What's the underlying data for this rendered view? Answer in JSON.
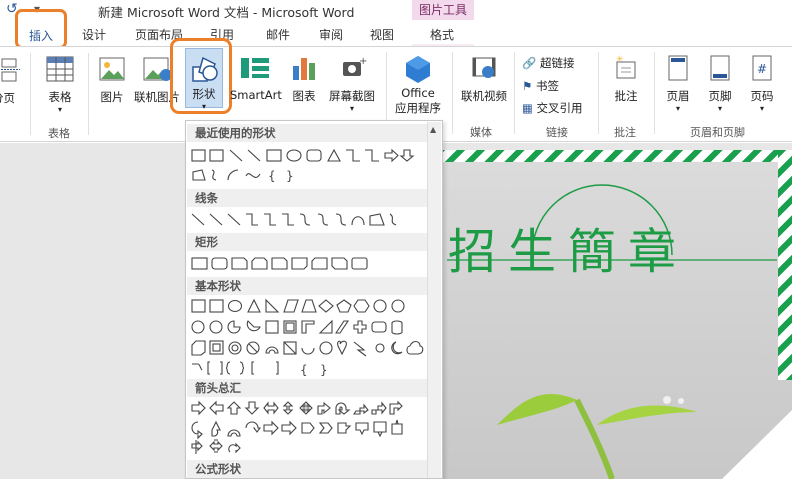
{
  "window": {
    "title": "新建 Microsoft Word 文档 - Microsoft Word",
    "context_group": "图片工具"
  },
  "tabs": [
    {
      "label": "插入"
    },
    {
      "label": "设计"
    },
    {
      "label": "页面布局"
    },
    {
      "label": "引用"
    },
    {
      "label": "邮件"
    },
    {
      "label": "审阅"
    },
    {
      "label": "视图"
    },
    {
      "label": "格式"
    }
  ],
  "ribbon": {
    "page": {
      "label": "分页"
    },
    "table": {
      "label": "表格",
      "group": "表格"
    },
    "picture": {
      "label": "图片"
    },
    "online_picture": {
      "label": "联机图片"
    },
    "shapes": {
      "label": "形状"
    },
    "smartart": {
      "label": "SmartArt"
    },
    "chart": {
      "label": "图表"
    },
    "screenshot": {
      "label": "屏幕截图"
    },
    "office_apps": {
      "label1": "Office",
      "label2": "应用程序"
    },
    "online_video": {
      "label": "联机视频",
      "group": "媒体"
    },
    "links": {
      "hyperlink": "超链接",
      "bookmark": "书签",
      "cross_ref": "交叉引用",
      "group": "链接"
    },
    "comment": {
      "label": "批注",
      "group": "批注"
    },
    "header": {
      "label": "页眉"
    },
    "footer": {
      "label": "页脚"
    },
    "page_number": {
      "label": "页码"
    },
    "header_footer_group": "页眉和页脚"
  },
  "shapes_menu": {
    "categories": [
      "最近使用的形状",
      "线条",
      "矩形",
      "基本形状",
      "箭头总汇",
      "公式形状"
    ]
  },
  "document": {
    "headline": "招生簡章"
  },
  "colors": {
    "accent": "#2b5797",
    "highlight": "#ec7f2a",
    "brand_green": "#1d9b45"
  }
}
